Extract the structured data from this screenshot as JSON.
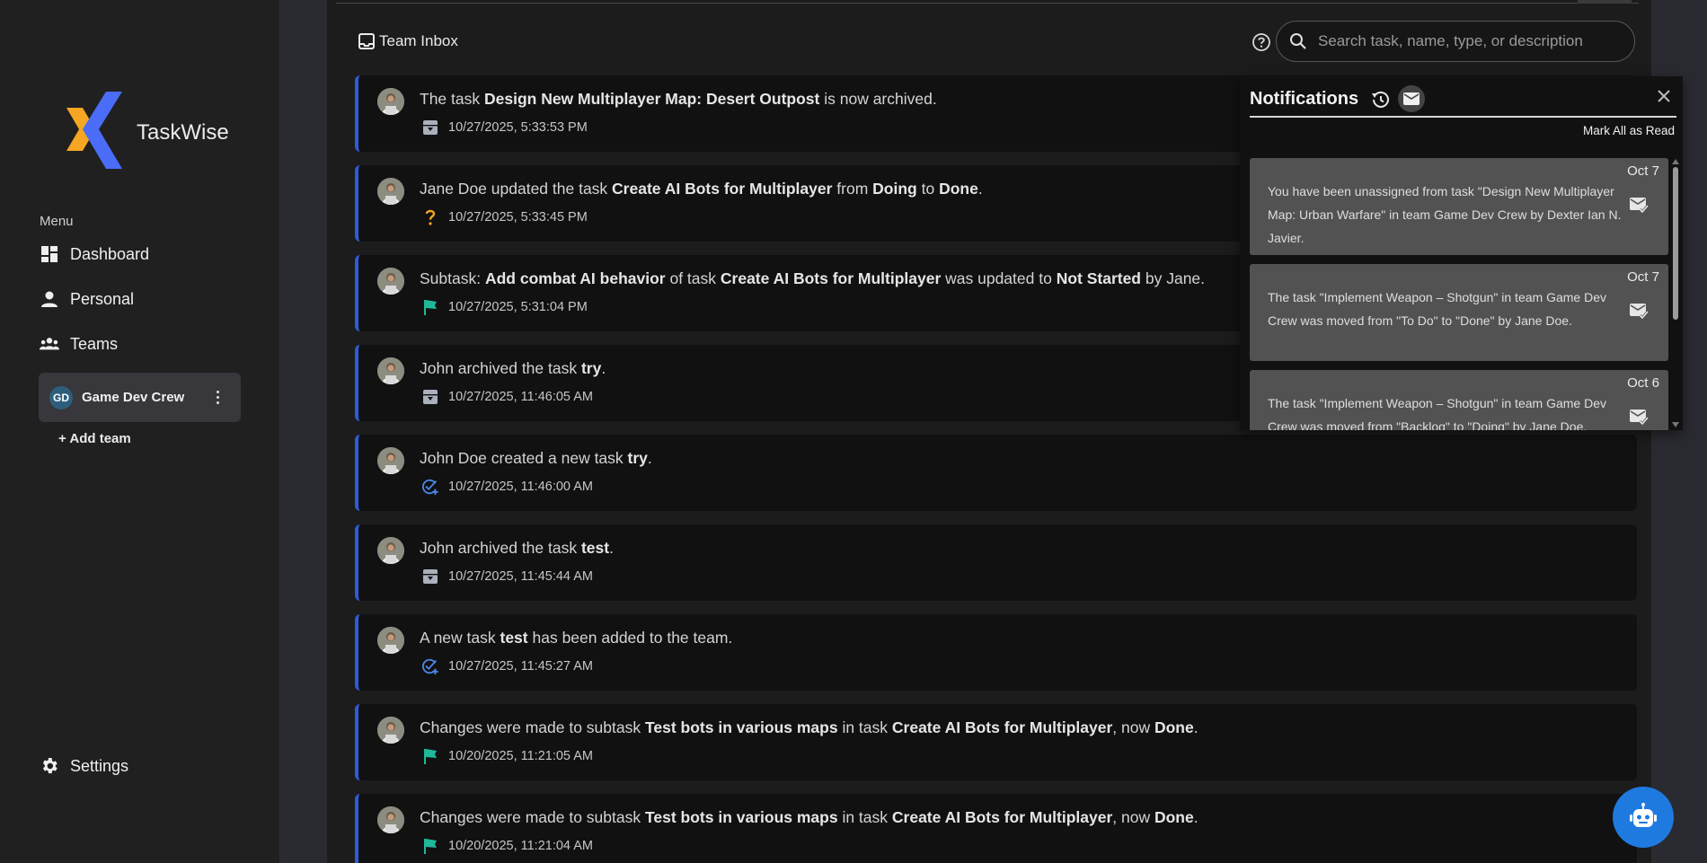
{
  "app": {
    "name": "TaskWise"
  },
  "sidebar": {
    "menu_heading": "Menu",
    "items": [
      {
        "label": "Dashboard",
        "icon": "dashboard-icon"
      },
      {
        "label": "Personal",
        "icon": "person-icon"
      },
      {
        "label": "Teams",
        "icon": "teams-icon"
      }
    ],
    "team": {
      "initials": "GD",
      "name": "Game Dev Crew"
    },
    "add_team": "+ Add team",
    "settings": "Settings"
  },
  "header": {
    "title": "Team Inbox",
    "search_placeholder": "Search task, name, type, or description"
  },
  "feed": [
    {
      "parts": [
        "The task ",
        "Design New Multiplayer Map: Desert Outpost",
        " is now archived."
      ],
      "time": "10/27/2025, 5:33:53 PM",
      "icon": "archive-icon"
    },
    {
      "parts": [
        "Jane Doe updated the task ",
        "Create AI Bots for Multiplayer",
        " from ",
        "Doing",
        " to ",
        "Done",
        "."
      ],
      "time": "10/27/2025, 5:33:45 PM",
      "icon": "question-icon"
    },
    {
      "parts": [
        "Subtask: ",
        "Add combat AI behavior",
        " of task ",
        "Create AI Bots for Multiplayer",
        " was updated to ",
        "Not Started",
        " by Jane."
      ],
      "time": "10/27/2025, 5:31:04 PM",
      "icon": "flag-icon"
    },
    {
      "parts": [
        "John archived the task ",
        "try",
        "."
      ],
      "time": "10/27/2025, 11:46:05 AM",
      "icon": "archive-icon"
    },
    {
      "parts": [
        "John Doe created a new task ",
        "try",
        "."
      ],
      "time": "10/27/2025, 11:46:00 AM",
      "icon": "task-added-icon"
    },
    {
      "parts": [
        "John archived the task ",
        "test",
        "."
      ],
      "time": "10/27/2025, 11:45:44 AM",
      "icon": "archive-icon"
    },
    {
      "parts": [
        "A new task ",
        "test",
        " has been added to the team."
      ],
      "time": "10/27/2025, 11:45:27 AM",
      "icon": "task-added-icon"
    },
    {
      "parts": [
        "Changes were made to subtask ",
        "Test bots in various maps",
        " in task ",
        "Create AI Bots for Multiplayer",
        ", now ",
        "Done",
        "."
      ],
      "time": "10/20/2025, 11:21:05 AM",
      "icon": "flag-icon"
    },
    {
      "parts": [
        "Changes were made to subtask ",
        "Test bots in various maps",
        " in task ",
        "Create AI Bots for Multiplayer",
        ", now ",
        "Done",
        "."
      ],
      "time": "10/20/2025, 11:21:04 AM",
      "icon": "flag-icon"
    }
  ],
  "notifications": {
    "title": "Notifications",
    "mark_all": "Mark All as Read",
    "items": [
      {
        "date": "Oct 7",
        "message": "You have been unassigned from task \"Design New Multiplayer Map: Urban Warfare\" in team Game Dev Crew by Dexter Ian N. Javier."
      },
      {
        "date": "Oct 7",
        "message": "The task \"Implement Weapon – Shotgun\" in team Game Dev Crew was moved from \"To Do\" to \"Done\" by Jane Doe."
      },
      {
        "date": "Oct 6",
        "message": "The task \"Implement Weapon – Shotgun\" in team Game Dev Crew was moved from \"Backlog\" to \"Doing\" by Jane Doe."
      }
    ]
  },
  "colors": {
    "accent": "#2f5bd8",
    "fab": "#1f7ae0",
    "logo_orange": "#f5a623",
    "logo_blue": "#4a6cf7",
    "flag": "#1fb89a"
  }
}
